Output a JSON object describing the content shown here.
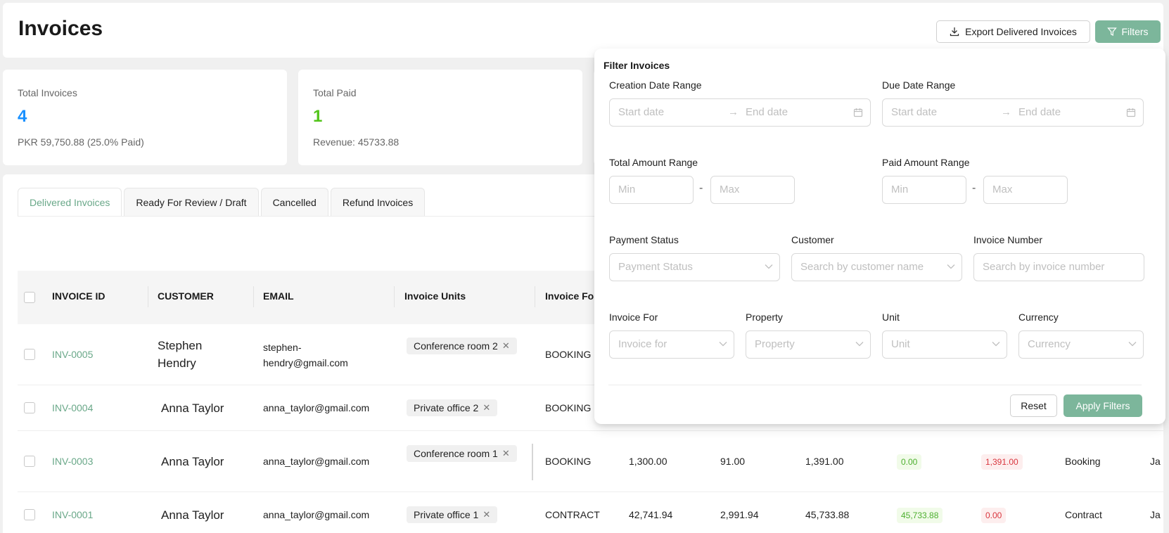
{
  "header": {
    "title": "Invoices",
    "export_label": "Export Delivered Invoices",
    "filters_label": "Filters"
  },
  "stats": [
    {
      "label": "Total Invoices",
      "value": "4",
      "sub": "PKR 59,750.88 (25.0% Paid)",
      "value_color": "#1890ff"
    },
    {
      "label": "Total Paid",
      "value": "1",
      "sub": "Revenue: 45733.88",
      "value_color": "#52c41a"
    }
  ],
  "tabs": [
    {
      "label": "Delivered Invoices",
      "active": true
    },
    {
      "label": "Ready For Review / Draft",
      "active": false
    },
    {
      "label": "Cancelled",
      "active": false
    },
    {
      "label": "Refund Invoices",
      "active": false
    }
  ],
  "table": {
    "columns": [
      "INVOICE ID",
      "CUSTOMER",
      "EMAIL",
      "Invoice Units",
      "Invoice For"
    ],
    "rows": [
      {
        "id": "INV-0005",
        "customer": "Stephen Hendry",
        "email": "stephen-hendry@gmail.com",
        "unit": "Conference room 2",
        "invoice_for": "BOOKING",
        "amount": "",
        "tax": "",
        "total": "",
        "paid": "",
        "due": "",
        "type": ""
      },
      {
        "id": "INV-0004",
        "customer": "Anna Taylor",
        "email": "anna_taylor@gmail.com",
        "unit": "Private office 2",
        "invoice_for": "BOOKING",
        "amount": "",
        "tax": "",
        "total": "",
        "paid": "",
        "due": "",
        "type": ""
      },
      {
        "id": "INV-0003",
        "customer": "Anna Taylor",
        "email": "anna_taylor@gmail.com",
        "unit": "Conference room 1",
        "invoice_for": "BOOKING",
        "amount": "1,300.00",
        "tax": "91.00",
        "total": "1,391.00",
        "paid": "0.00",
        "due": "1,391.00",
        "type": "Booking",
        "date_fragment": "Ja"
      },
      {
        "id": "INV-0001",
        "customer": "Anna Taylor",
        "email": "anna_taylor@gmail.com",
        "unit": "Private office 1",
        "invoice_for": "CONTRACT",
        "amount": "42,741.94",
        "tax": "2,991.94",
        "total": "45,733.88",
        "paid": "45,733.88",
        "due": "0.00",
        "type": "Contract",
        "date_fragment": "Ja"
      }
    ]
  },
  "filter_panel": {
    "title": "Filter Invoices",
    "creation_date": {
      "label": "Creation Date Range",
      "start": "Start date",
      "end": "End date"
    },
    "due_date": {
      "label": "Due Date Range",
      "start": "Start date",
      "end": "End date"
    },
    "total_amount": {
      "label": "Total Amount Range",
      "min": "Min",
      "max": "Max"
    },
    "paid_amount": {
      "label": "Paid Amount Range",
      "min": "Min",
      "max": "Max"
    },
    "payment_status": {
      "label": "Payment Status",
      "placeholder": "Payment Status"
    },
    "customer": {
      "label": "Customer",
      "placeholder": "Search by customer name"
    },
    "invoice_number": {
      "label": "Invoice Number",
      "placeholder": "Search by invoice number"
    },
    "invoice_for": {
      "label": "Invoice For",
      "placeholder": "Invoice for"
    },
    "property": {
      "label": "Property",
      "placeholder": "Property"
    },
    "unit": {
      "label": "Unit",
      "placeholder": "Unit"
    },
    "currency": {
      "label": "Currency",
      "placeholder": "Currency"
    },
    "dash": "-",
    "arrow": "→",
    "reset_label": "Reset",
    "apply_label": "Apply Filters"
  },
  "colors": {
    "accent": "#7cb69b",
    "link": "#6aa889"
  }
}
